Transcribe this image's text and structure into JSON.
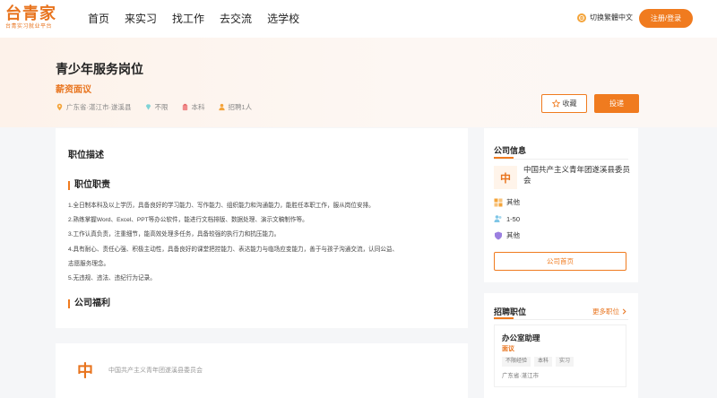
{
  "header": {
    "logo_text": "台青家",
    "logo_sub": "台青实习就业平台",
    "nav": [
      "首页",
      "来实习",
      "找工作",
      "去交流",
      "选学校"
    ],
    "lang_switch": "切换繁體中文",
    "login_label": "注册/登录"
  },
  "job": {
    "title": "青少年服务岗位",
    "salary": "薪资面议",
    "location": "广东省·湛江市·遂溪县",
    "experience": "不限",
    "education": "本科",
    "headcount": "招聘1人",
    "fav_label": "收藏",
    "apply_label": "投递"
  },
  "description": {
    "heading": "职位描述",
    "duties_title": "职位职责",
    "duties": [
      "1.全日制本科及以上学历，具备良好的学习能力、写作能力、组织能力和沟通能力，能胜任本职工作，服从岗位安排。",
      "2.熟练掌握Word、Excel、PPT等办公软件，能进行文档排版、数据处理、演示文稿制作等。",
      "3.工作认真负责，注重细节，能高效处理多任务，具备较强的执行力和抗压能力。",
      "4.具有耐心、责任心强、积极主动性，具备良好的课堂把控能力、表达能力与临场应变能力，善于与孩子沟通交流，认同公益、",
      "志愿服务理念。",
      "5.无违规、违法、违纪行为记录。"
    ],
    "welfare_title": "公司福利"
  },
  "company_strip": {
    "logo_char": "中",
    "name": "中国共产主义青年团遂溪县委员会"
  },
  "company_info": {
    "heading": "公司信息",
    "logo_char": "中",
    "name": "中国共产主义青年团遂溪县委员会",
    "industry": "其他",
    "size": "1-50",
    "type": "其他",
    "home_label": "公司首页"
  },
  "recruiting": {
    "heading": "招聘职位",
    "more_label": "更多职位",
    "jobs": [
      {
        "title": "办公室助理",
        "salary": "面议",
        "tags": [
          "不限经验",
          "本科",
          "实习"
        ],
        "location": "广东省·湛江市"
      }
    ]
  },
  "colors": {
    "accent": "#f07b1f",
    "page_bg": "#f5f6f8"
  }
}
